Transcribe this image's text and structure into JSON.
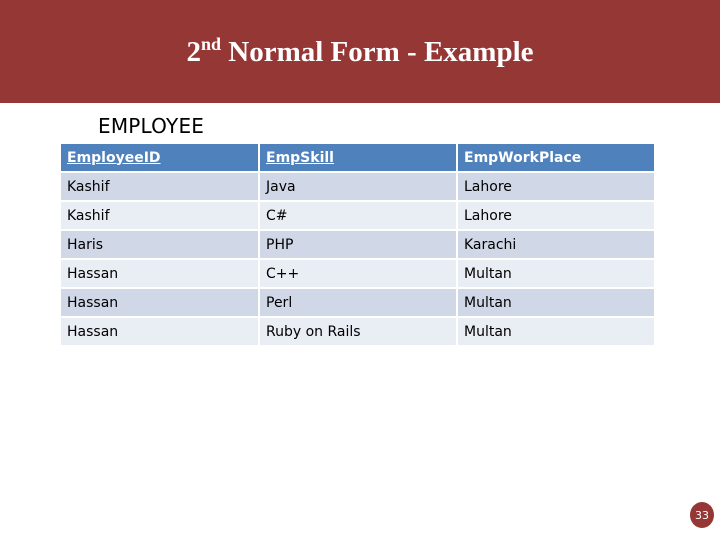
{
  "slide": {
    "title_number": "2",
    "title_superscript": "nd",
    "title_rest": " Normal Form - Example",
    "table_caption": "EMPLOYEE",
    "page_number": "33"
  },
  "colors": {
    "title_bar": "#953735",
    "header": "#4f81bd",
    "row_odd": "#d0d8e8",
    "row_even": "#e9edf4"
  },
  "table": {
    "headers": [
      {
        "label": "EmployeeID",
        "key": true
      },
      {
        "label": "EmpSkill",
        "key": true
      },
      {
        "label": "EmpWorkPlace",
        "key": false
      }
    ],
    "rows": [
      [
        "Kashif",
        "Java",
        "Lahore"
      ],
      [
        "Kashif",
        "C#",
        "Lahore"
      ],
      [
        "Haris",
        "PHP",
        "Karachi"
      ],
      [
        "Hassan",
        "C++",
        "Multan"
      ],
      [
        "Hassan",
        "Perl",
        "Multan"
      ],
      [
        "Hassan",
        "Ruby on Rails",
        "Multan"
      ]
    ]
  }
}
